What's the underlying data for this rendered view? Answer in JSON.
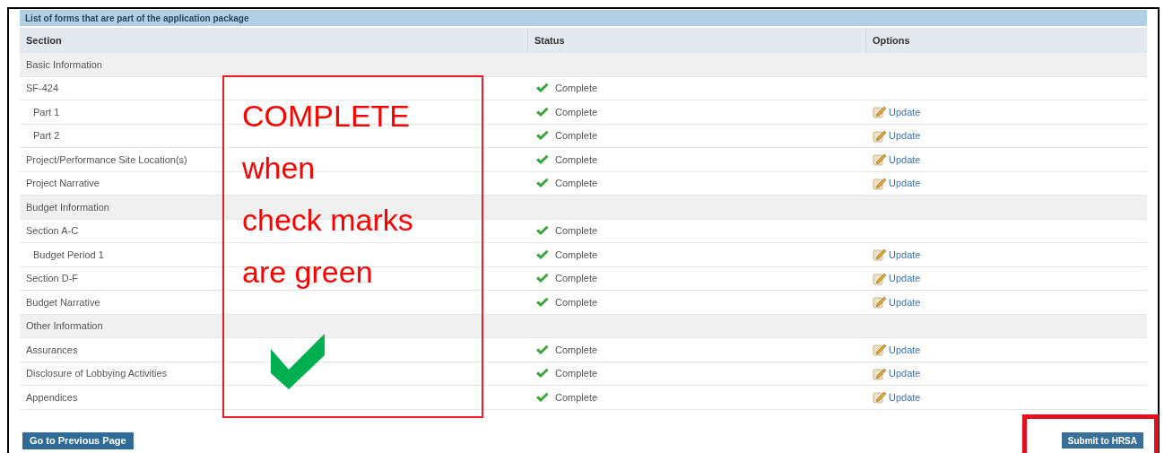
{
  "panel": {
    "title": "List of forms that are part of the application package"
  },
  "table": {
    "columns": [
      "Section",
      "Status",
      "Options"
    ],
    "rows": [
      {
        "kind": "group",
        "section": "Basic Information"
      },
      {
        "kind": "form",
        "section": "SF-424",
        "status": "Complete",
        "children": [
          {
            "kind": "form",
            "section": "Part 1",
            "status": "Complete",
            "option": "Update"
          },
          {
            "kind": "form",
            "section": "Part 2",
            "status": "Complete",
            "option": "Update"
          }
        ]
      },
      {
        "kind": "form",
        "section": "Project/Performance Site Location(s)",
        "status": "Complete",
        "option": "Update"
      },
      {
        "kind": "form",
        "section": "Project Narrative",
        "status": "Complete",
        "option": "Update"
      },
      {
        "kind": "group",
        "section": "Budget Information"
      },
      {
        "kind": "form",
        "section": "Section A-C",
        "status": "Complete",
        "children": [
          {
            "kind": "form",
            "section": "Budget Period 1",
            "status": "Complete",
            "option": "Update"
          }
        ]
      },
      {
        "kind": "form",
        "section": "Section D-F",
        "status": "Complete",
        "option": "Update"
      },
      {
        "kind": "form",
        "section": "Budget Narrative",
        "status": "Complete",
        "option": "Update"
      },
      {
        "kind": "group",
        "section": "Other Information"
      },
      {
        "kind": "form",
        "section": "Assurances",
        "status": "Complete",
        "option": "Update"
      },
      {
        "kind": "form",
        "section": "Disclosure of Lobbying Activities",
        "status": "Complete",
        "option": "Update"
      },
      {
        "kind": "form",
        "section": "Appendices",
        "status": "Complete",
        "option": "Update"
      }
    ]
  },
  "buttons": {
    "previous": "Go to Previous Page",
    "submit": "Submit to HRSA"
  },
  "annotation": {
    "text": "COMPLETE\nwhen\ncheck marks\nare green"
  }
}
